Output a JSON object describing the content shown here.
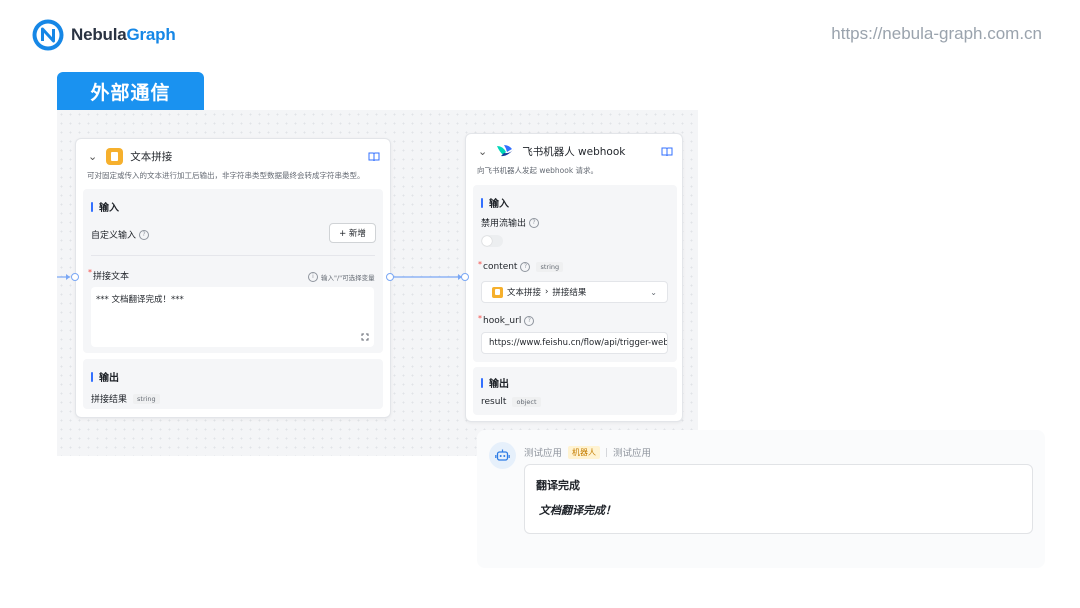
{
  "header": {
    "logo_prefix": "Nebula",
    "logo_suffix": "Graph",
    "site_url": "https://nebula-graph.com.cn"
  },
  "section": {
    "title": "外部通信"
  },
  "colors": {
    "accent": "#1a92f0",
    "text_node_icon": "#f6b02d",
    "section_bar": "#3370ff",
    "required": "#f54a45"
  },
  "node_text": {
    "icon": "text-doc-icon",
    "title": "文本拼接",
    "description": "可对固定或传入的文本进行加工后输出，非字符串类型数据最终会转成字符串类型。",
    "input_title": "输入",
    "custom_input_label": "自定义输入",
    "add_button": "+ 新增",
    "concat_label": "拼接文本",
    "concat_hint": "输入\"/\"可选择变量",
    "concat_value": "*** 文档翻译完成！***",
    "output_title": "输出",
    "output_name": "拼接结果",
    "output_type": "string"
  },
  "node_webhook": {
    "icon": "feishu-bird-icon",
    "title": "飞书机器人 webhook",
    "description": "向飞书机器人发起 webhook 请求。",
    "input_title": "输入",
    "disable_stream_label": "禁用流输出",
    "disable_stream_on": false,
    "content_label": "content",
    "content_type": "string",
    "content_source_node": "文本拼接",
    "content_source_field": "拼接结果",
    "hook_url_label": "hook_url",
    "hook_url_value": "https://www.feishu.cn/flow/api/trigger-web",
    "output_title": "输出",
    "output_name": "result",
    "output_type": "object"
  },
  "chat": {
    "sender": "测试应用",
    "badge": "机器人",
    "channel": "测试应用",
    "message_title": "翻译完成",
    "message_body": "文档翻译完成！"
  }
}
